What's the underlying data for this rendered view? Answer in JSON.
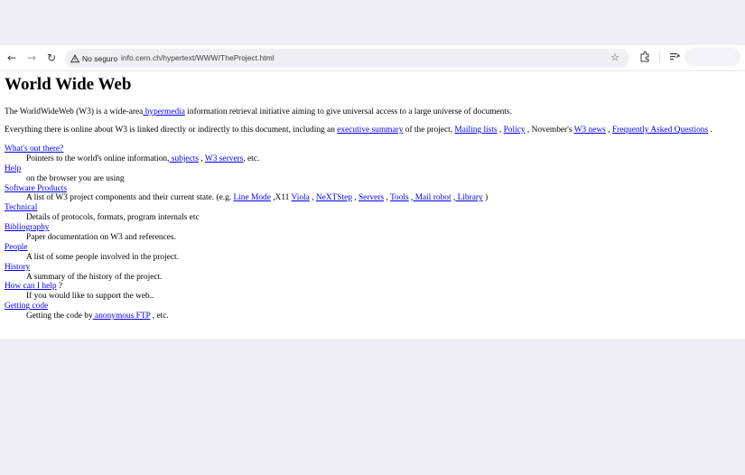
{
  "browser": {
    "security_label": "No seguro",
    "url": "info.cern.ch/hypertext/WWW/TheProject.html"
  },
  "page": {
    "title": "World Wide Web",
    "intro": {
      "t1": "The WorldWideWeb (W3) is a wide-area",
      "link_hypermedia": " hypermedia",
      "t2": " information retrieval initiative aiming to give universal access to a large universe of documents."
    },
    "intro2": {
      "t1": "Everything there is online about W3 is linked directly or indirectly to this document, including an ",
      "link_exec": "executive summary",
      "t2": " of the project, ",
      "link_mailing": "Mailing lists",
      "t3": " , ",
      "link_policy": "Policy",
      "t4": " , November's ",
      "link_news": "W3 news",
      "t5": " , ",
      "link_faq": "Frequently Asked Questions",
      "t6": " ."
    },
    "items": {
      "whats": {
        "term": "What's out there?",
        "d1": "Pointers to the world's online information,",
        "l_subjects": " subjects",
        "d2": " , ",
        "l_servers": "W3 servers",
        "d3": ", etc."
      },
      "help": {
        "term": "Help",
        "desc": "on the browser you are using"
      },
      "software": {
        "term": "Software Products",
        "d1": "A list of W3 project components and their current state. (e.g. ",
        "l_linemode": "Line Mode",
        "d2": " ,X11 ",
        "l_viola": "Viola",
        "d3": " , ",
        "l_nextstep": "NeXTStep",
        "d4": " , ",
        "l_servers": "Servers",
        "d5": " , ",
        "l_tools": "Tools",
        "d6": " ,",
        "l_mailrobot": " Mail robot",
        "d7": " ,",
        "l_library": " Library",
        "d8": " )"
      },
      "technical": {
        "term": "Technical",
        "desc": "Details of protocols, formats, program internals etc"
      },
      "bibliography": {
        "term": "Bibliography",
        "desc": "Paper documentation on W3 and references."
      },
      "people": {
        "term": "People",
        "desc": "A list of some people involved in the project."
      },
      "history": {
        "term": "History",
        "desc": "A summary of the history of the project."
      },
      "howcan": {
        "term": "How can I help",
        "suffix": " ?",
        "desc": "If you would like to support the web.."
      },
      "getting": {
        "term": "Getting code",
        "d1": "Getting the code by",
        "l_ftp": " anonymous FTP",
        "d2": " , etc."
      }
    }
  }
}
